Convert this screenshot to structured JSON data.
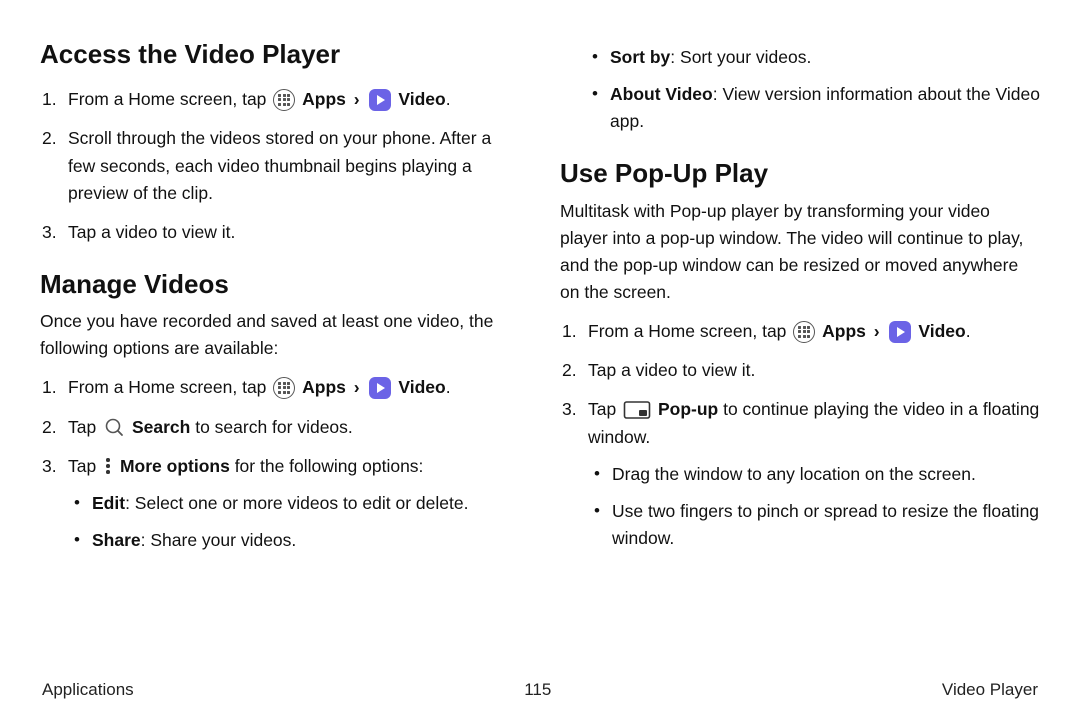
{
  "left": {
    "heading_access": "Access the Video Player",
    "access_steps": [
      {
        "prefix": "From a Home screen, tap ",
        "apps_label": "Apps",
        "sep": " › ",
        "video_label": "Video",
        "suffix": "."
      },
      {
        "text": "Scroll through the videos stored on your phone. After a few seconds, each video thumbnail begins playing a preview of the clip."
      },
      {
        "text": "Tap a video to view it."
      }
    ],
    "heading_manage": "Manage Videos",
    "manage_intro": "Once you have recorded and saved at least one video, the following options are available:",
    "manage_step1": {
      "prefix": "From a Home screen, tap ",
      "apps_label": "Apps",
      "sep": " › ",
      "video_label": "Video",
      "suffix": "."
    },
    "manage_step2": {
      "prefix": "Tap ",
      "search_label": "Search",
      "suffix": " to search for videos."
    },
    "manage_step3": {
      "prefix": "Tap ",
      "more_label": "More options",
      "suffix": " for the following options:"
    },
    "manage_bullets": [
      {
        "bold": "Edit",
        "rest": ": Select one or more videos to edit or delete."
      },
      {
        "bold": "Share",
        "rest": ": Share your videos."
      }
    ]
  },
  "right": {
    "top_bullets": [
      {
        "bold": "Sort by",
        "rest": ": Sort your videos."
      },
      {
        "bold": "About Video",
        "rest": ": View version information about the Video app."
      }
    ],
    "heading_popup": "Use Pop-Up Play",
    "popup_intro": "Multitask with Pop-up player by transforming your video player into a pop-up window. The video will continue to play, and the pop-up window can be resized or moved anywhere on the screen.",
    "popup_step1": {
      "prefix": "From a Home screen, tap ",
      "apps_label": "Apps",
      "sep": " › ",
      "video_label": "Video",
      "suffix": "."
    },
    "popup_step2": "Tap a video to view it.",
    "popup_step3": {
      "prefix": "Tap ",
      "popup_label": "Pop-up",
      "suffix": " to continue playing the video in a floating window."
    },
    "popup_bullets": [
      "Drag the window to any location on the screen.",
      "Use two fingers to pinch or spread to resize the floating window."
    ]
  },
  "footer": {
    "left": "Applications",
    "center": "115",
    "right": "Video Player"
  }
}
